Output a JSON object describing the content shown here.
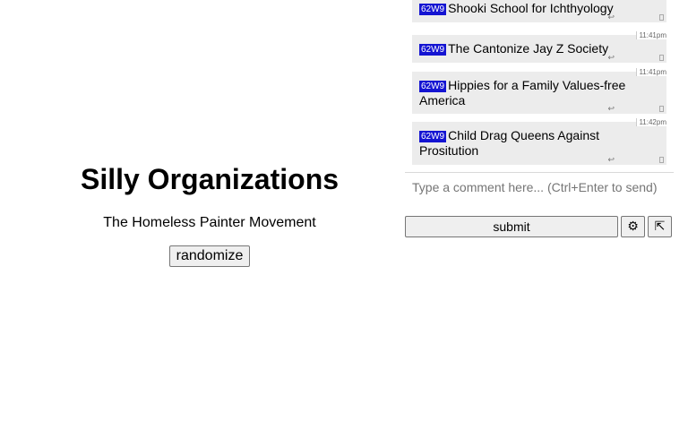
{
  "app": {
    "title": "Silly Organizations",
    "current_organization": "The Homeless Painter Movement",
    "randomize_label": "randomize"
  },
  "chat": {
    "messages": [
      {
        "tag": "62W9",
        "text": "Shooki School for Ichthyology",
        "time": ""
      },
      {
        "tag": "62W9",
        "text": "The Cantonize Jay Z Society",
        "time": "11:41pm"
      },
      {
        "tag": "62W9",
        "text": "Hippies for a Family Values-free America",
        "time": "11:41pm"
      },
      {
        "tag": "62W9",
        "text": "Child Drag Queens Against Prositution",
        "time": "11:42pm"
      }
    ],
    "reply_icon": "↩",
    "input_placeholder": "Type a comment here... (Ctrl+Enter to send)",
    "input_value": "",
    "submit_label": "submit",
    "settings_icon": "⚙",
    "popout_icon": "⇱"
  },
  "colors": {
    "tag_background": "#1414d2",
    "message_background": "#ececec"
  }
}
